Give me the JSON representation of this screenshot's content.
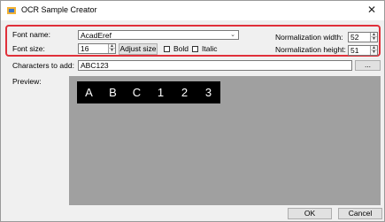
{
  "window": {
    "title": "OCR Sample Creator",
    "close_glyph": "✕"
  },
  "font": {
    "name_label": "Font name:",
    "name_value": "AcadEref",
    "size_label": "Font size:",
    "size_value": "16",
    "adjust_label": "Adjust size",
    "bold_label": "Bold",
    "italic_label": "Italic",
    "bold_checked": false,
    "italic_checked": false
  },
  "normalization": {
    "width_label": "Normalization width:",
    "width_value": "52",
    "height_label": "Normalization height:",
    "height_value": "51"
  },
  "characters": {
    "label": "Characters to add:",
    "value": "ABC123",
    "browse_label": "..."
  },
  "preview": {
    "label": "Preview:",
    "chars": [
      "A",
      "B",
      "C",
      "1",
      "2",
      "3"
    ]
  },
  "buttons": {
    "ok": "OK",
    "cancel": "Cancel"
  },
  "colors": {
    "highlight": "#e0303a",
    "preview_bg": "#a0a0a0",
    "tile_bg": "#000000"
  }
}
